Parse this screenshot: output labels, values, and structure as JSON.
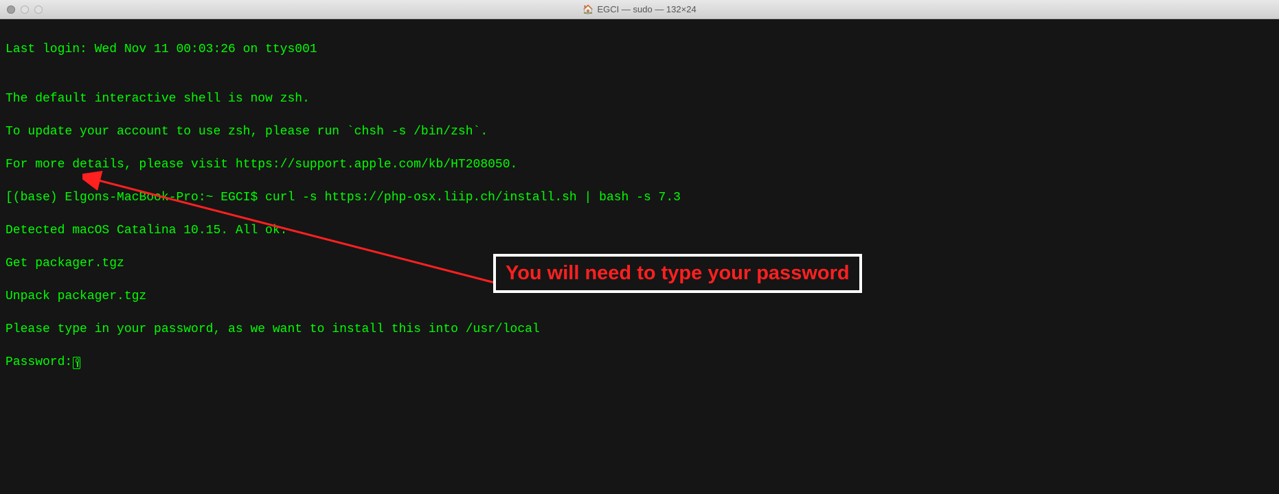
{
  "window": {
    "title": "EGCI — sudo — 132×24"
  },
  "terminal": {
    "lines": [
      "Last login: Wed Nov 11 00:03:26 on ttys001",
      "",
      "The default interactive shell is now zsh.",
      "To update your account to use zsh, please run `chsh -s /bin/zsh`.",
      "For more details, please visit https://support.apple.com/kb/HT208050.",
      "[(base) Elgons-MacBook-Pro:~ EGCI$ curl -s https://php-osx.liip.ch/install.sh | bash -s 7.3",
      "Detected macOS Catalina 10.15. All ok.",
      "Get packager.tgz",
      "Unpack packager.tgz",
      "Please type in your password, as we want to install this into /usr/local"
    ],
    "password_prompt": "Password:"
  },
  "annotation": {
    "text": "You will need to type your password"
  }
}
